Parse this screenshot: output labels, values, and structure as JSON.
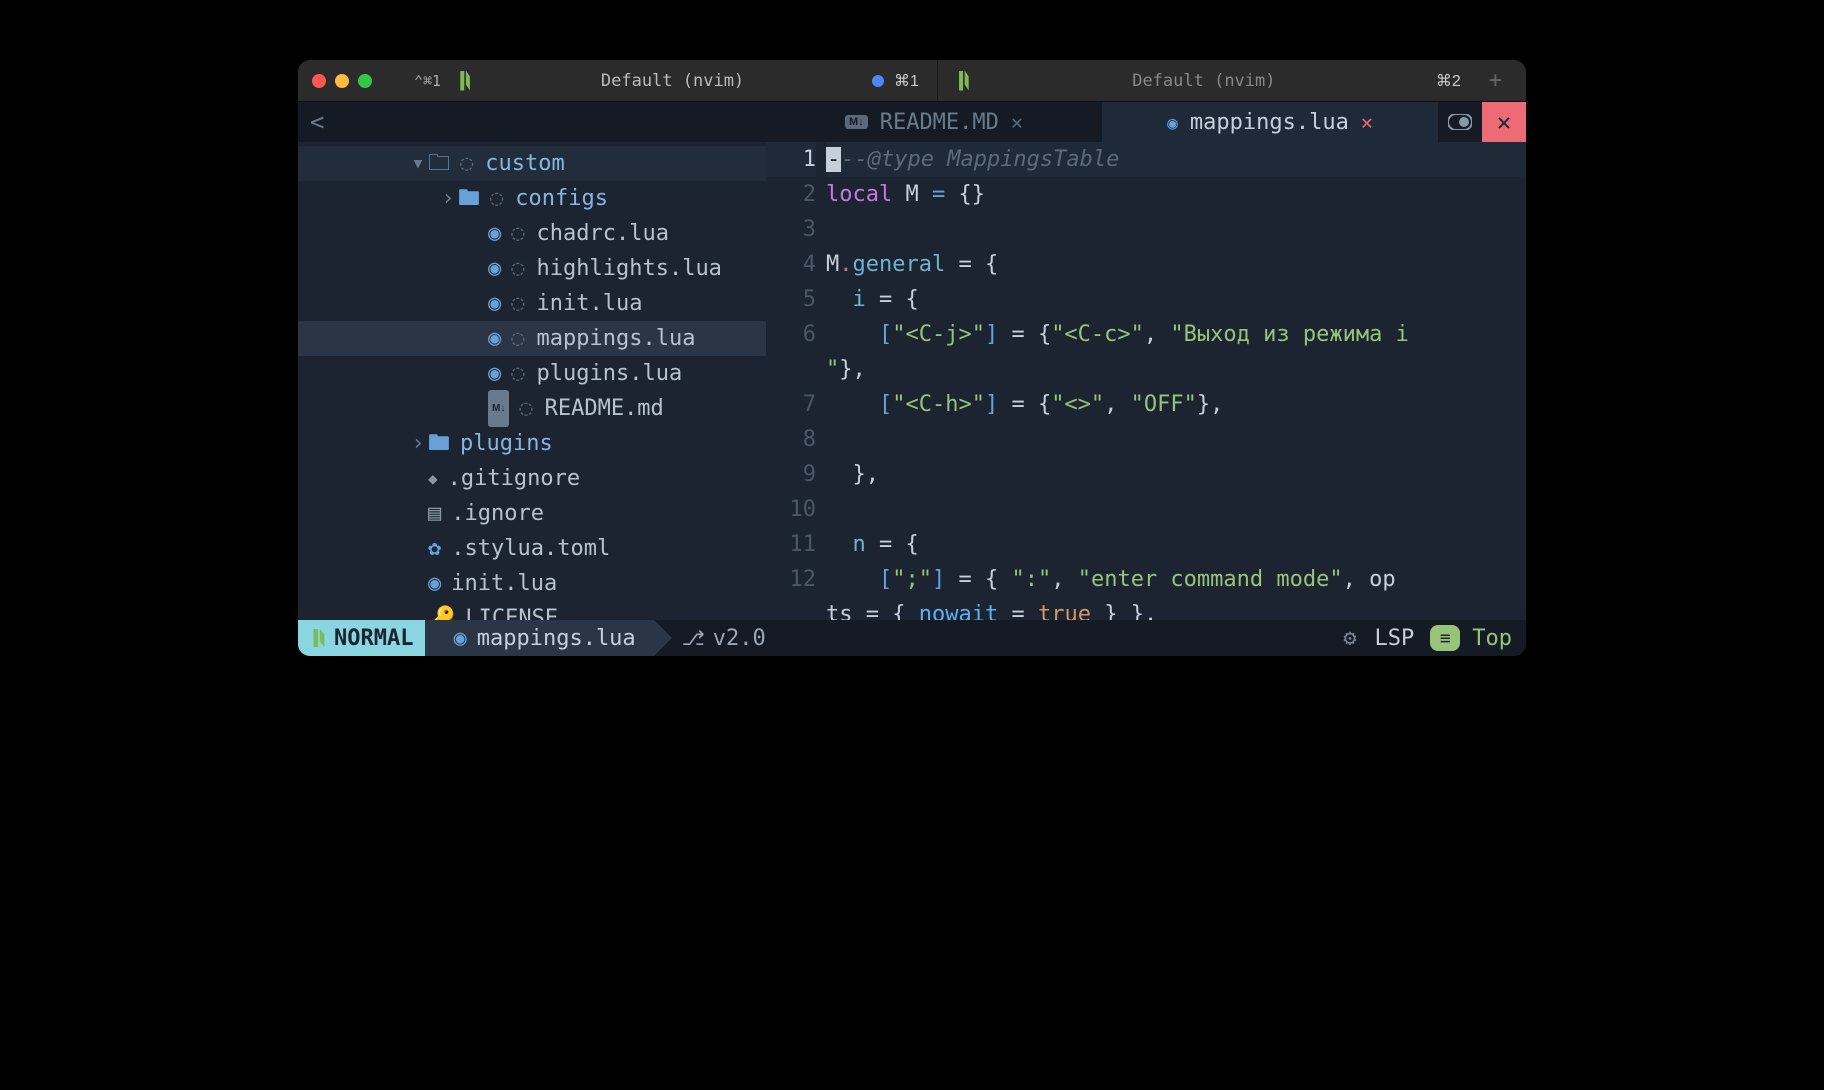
{
  "titlebar": {
    "tabs": [
      {
        "shortcut_badge": "⌃⌘1",
        "label": "Default (nvim)",
        "cmd": "⌘1",
        "has_dot": true
      },
      {
        "shortcut_badge": "",
        "label": "Default (nvim)",
        "cmd": "⌘2",
        "has_dot": false
      }
    ]
  },
  "buffer_tabs": {
    "tree_header": "<",
    "tabs": [
      {
        "icon": "md",
        "name": "README.MD",
        "active": false
      },
      {
        "icon": "lua",
        "name": "mappings.lua",
        "active": true
      }
    ]
  },
  "filetree": {
    "rows": [
      {
        "depth": 3,
        "chevron": "▾",
        "icon": "folder-open-dotted",
        "name": "custom",
        "kind": "dir",
        "highlight": true
      },
      {
        "depth": 4,
        "chevron": "›",
        "icon": "folder-dotted",
        "name": "configs",
        "kind": "dir"
      },
      {
        "depth": 5,
        "chevron": "",
        "icon": "lua-dotted",
        "name": "chadrc.lua",
        "kind": "file"
      },
      {
        "depth": 5,
        "chevron": "",
        "icon": "lua-dotted",
        "name": "highlights.lua",
        "kind": "file"
      },
      {
        "depth": 5,
        "chevron": "",
        "icon": "lua-dotted",
        "name": "init.lua",
        "kind": "file"
      },
      {
        "depth": 5,
        "chevron": "",
        "icon": "lua-dotted",
        "name": "mappings.lua",
        "kind": "file",
        "selected": true
      },
      {
        "depth": 5,
        "chevron": "",
        "icon": "lua-dotted",
        "name": "plugins.lua",
        "kind": "file"
      },
      {
        "depth": 5,
        "chevron": "",
        "icon": "md-dotted",
        "name": "README.md",
        "kind": "file"
      },
      {
        "depth": 3,
        "chevron": "›",
        "icon": "folder",
        "name": "plugins",
        "kind": "dir"
      },
      {
        "depth": 3,
        "chevron": "",
        "icon": "diamond",
        "name": ".gitignore",
        "kind": "file"
      },
      {
        "depth": 3,
        "chevron": "",
        "icon": "doc",
        "name": ".ignore",
        "kind": "file"
      },
      {
        "depth": 3,
        "chevron": "",
        "icon": "gear",
        "name": ".stylua.toml",
        "kind": "file"
      },
      {
        "depth": 3,
        "chevron": "",
        "icon": "lua",
        "name": "init.lua",
        "kind": "file"
      },
      {
        "depth": 3,
        "chevron": "",
        "icon": "key",
        "name": "LICENSE",
        "kind": "file"
      }
    ]
  },
  "editor": {
    "lines": [
      {
        "n": 1,
        "current": true,
        "segments": [
          {
            "t": "-",
            "cls": "cursor-block"
          },
          {
            "t": "--@type MappingsTable",
            "cls": "tok-comment"
          }
        ]
      },
      {
        "n": 2,
        "segments": [
          {
            "t": "local",
            "cls": "tok-keyword"
          },
          {
            "t": " M ",
            "cls": "tok-ident"
          },
          {
            "t": "=",
            "cls": "tok-punct"
          },
          {
            "t": " {}",
            "cls": "tok-brace"
          }
        ]
      },
      {
        "n": 3,
        "segments": [
          {
            "t": "  ",
            "cls": ""
          }
        ]
      },
      {
        "n": 4,
        "segments": [
          {
            "t": "M",
            "cls": "tok-ident"
          },
          {
            "t": ".",
            "cls": "tok-dot"
          },
          {
            "t": "general",
            "cls": "tok-field"
          },
          {
            "t": " = {",
            "cls": "tok-brace"
          }
        ]
      },
      {
        "n": 5,
        "segments": [
          {
            "t": "  ",
            "cls": ""
          },
          {
            "t": "i",
            "cls": "tok-field"
          },
          {
            "t": " = {",
            "cls": "tok-brace"
          }
        ]
      },
      {
        "n": 6,
        "segments": [
          {
            "t": "    ",
            "cls": ""
          },
          {
            "t": "[",
            "cls": "tok-punct"
          },
          {
            "t": "\"<C-j>\"",
            "cls": "tok-string"
          },
          {
            "t": "]",
            "cls": "tok-punct"
          },
          {
            "t": " = {",
            "cls": "tok-brace"
          },
          {
            "t": "\"<C-c>\"",
            "cls": "tok-string"
          },
          {
            "t": ", ",
            "cls": "tok-brace"
          },
          {
            "t": "\"Выход из режима i",
            "cls": "tok-string"
          }
        ]
      },
      {
        "n": null,
        "segments": [
          {
            "t": "\"",
            "cls": "tok-string"
          },
          {
            "t": "},",
            "cls": "tok-brace"
          }
        ]
      },
      {
        "n": 7,
        "segments": [
          {
            "t": "    ",
            "cls": ""
          },
          {
            "t": "[",
            "cls": "tok-punct"
          },
          {
            "t": "\"<C-h>\"",
            "cls": "tok-string"
          },
          {
            "t": "]",
            "cls": "tok-punct"
          },
          {
            "t": " = {",
            "cls": "tok-brace"
          },
          {
            "t": "\"<>\"",
            "cls": "tok-string"
          },
          {
            "t": ", ",
            "cls": "tok-brace"
          },
          {
            "t": "\"OFF\"",
            "cls": "tok-string"
          },
          {
            "t": "},",
            "cls": "tok-brace"
          }
        ]
      },
      {
        "n": 8,
        "segments": [
          {
            "t": "  ",
            "cls": ""
          }
        ]
      },
      {
        "n": 9,
        "segments": [
          {
            "t": "  },",
            "cls": "tok-brace"
          }
        ]
      },
      {
        "n": 10,
        "segments": [
          {
            "t": "  ",
            "cls": ""
          }
        ]
      },
      {
        "n": 11,
        "segments": [
          {
            "t": "  ",
            "cls": ""
          },
          {
            "t": "n",
            "cls": "tok-field"
          },
          {
            "t": " = {",
            "cls": "tok-brace"
          }
        ]
      },
      {
        "n": 12,
        "segments": [
          {
            "t": "    ",
            "cls": ""
          },
          {
            "t": "[",
            "cls": "tok-punct"
          },
          {
            "t": "\";\"",
            "cls": "tok-string"
          },
          {
            "t": "]",
            "cls": "tok-punct"
          },
          {
            "t": " = { ",
            "cls": "tok-brace"
          },
          {
            "t": "\":\"",
            "cls": "tok-string"
          },
          {
            "t": ", ",
            "cls": "tok-brace"
          },
          {
            "t": "\"enter command mode\"",
            "cls": "tok-string"
          },
          {
            "t": ", ",
            "cls": "tok-brace"
          },
          {
            "t": "op",
            "cls": "tok-ident"
          }
        ]
      },
      {
        "n": null,
        "segments": [
          {
            "t": "ts",
            "cls": "tok-ident"
          },
          {
            "t": " = { ",
            "cls": "tok-brace"
          },
          {
            "t": "nowait",
            "cls": "tok-prop"
          },
          {
            "t": " = ",
            "cls": "tok-brace"
          },
          {
            "t": "true",
            "cls": "tok-orange"
          },
          {
            "t": " } },",
            "cls": "tok-brace"
          }
        ]
      }
    ]
  },
  "statusline": {
    "mode": "NORMAL",
    "file": "mappings.lua",
    "git_branch": "v2.0",
    "lsp": "LSP",
    "position": "Top"
  }
}
